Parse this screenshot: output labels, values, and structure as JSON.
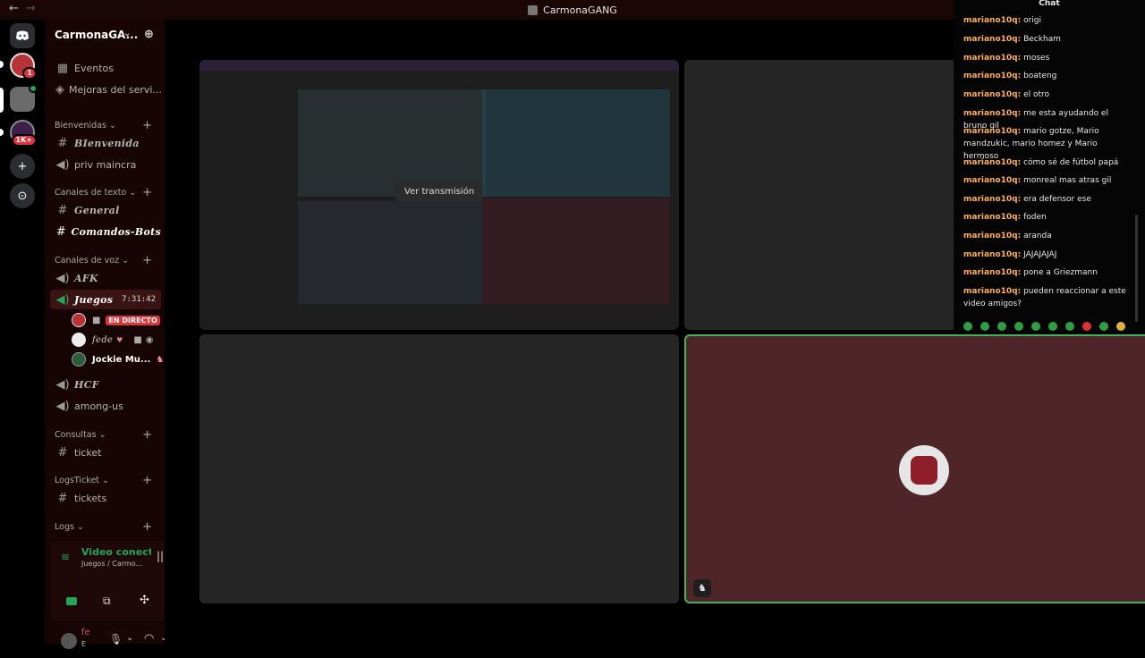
{
  "window": {
    "title": "CarmonaGANG",
    "back": "←",
    "forward": "→"
  },
  "guilds": [
    {
      "name": "discord-home",
      "glyph": "◎"
    },
    {
      "name": "server-1",
      "badge": "1"
    },
    {
      "name": "server-2"
    },
    {
      "name": "server-3",
      "badge": "1K+"
    },
    {
      "name": "add-server",
      "glyph": "+"
    },
    {
      "name": "discover",
      "glyph": "⊙"
    }
  ],
  "server": {
    "name": "CarmonaGA...",
    "chevron": "⌄",
    "invite": "⊕"
  },
  "top_items": [
    {
      "label": "Eventos",
      "icon": "▦"
    },
    {
      "label": "Mejoras del servi...",
      "icon": "◈"
    }
  ],
  "categories": {
    "bienvenidas": "Bienvenidas",
    "texto": "Canales de texto",
    "voz": "Canales de voz",
    "consultas": "Consultas",
    "logsticket": "LogsTicket",
    "logs": "Logs"
  },
  "channels": {
    "bienvenida": "BIenvenida",
    "priv_maincra": "priv maincra",
    "general": "General",
    "comandos": "Comandos-Bots",
    "afk": "AFK",
    "juegos": "Juegos",
    "juegos_timer": "7:31:42",
    "hcf": "HCF",
    "among": "among-us",
    "ticket": "ticket",
    "tickets": "tickets"
  },
  "voice_users": [
    {
      "name": "",
      "live": "EN DIRECTO"
    },
    {
      "name": "fede"
    },
    {
      "name": "Jockie Mu..."
    }
  ],
  "voice_panel": {
    "status": "Video conectac",
    "location": "Juegos / Carmo..."
  },
  "user": {
    "name": "fe",
    "status": "E"
  },
  "stage": {
    "watch_button": "Ver transmisión"
  },
  "chat": {
    "title": "Chat",
    "messages": [
      {
        "user": "mariano10q:",
        "text": " origi"
      },
      {
        "user": "mariano10q:",
        "text": " Beckham"
      },
      {
        "user": "mariano10q:",
        "text": " moses"
      },
      {
        "user": "mariano10q:",
        "text": " boateng"
      },
      {
        "user": "mariano10q:",
        "text": " el otro"
      },
      {
        "user": "mariano10q:",
        "text": " me esta ayudando el bruno gil"
      },
      {
        "user": "mariano10q:",
        "text": " mario gotze, Mario mandzukic, mario homez y Mario hermoso"
      },
      {
        "user": "mariano10q:",
        "text": " cómo sé de fútbol papá"
      },
      {
        "user": "mariano10q:",
        "text": " monreal mas atras gil"
      },
      {
        "user": "mariano10q:",
        "text": " era defensor ese"
      },
      {
        "user": "mariano10q:",
        "text": " foden"
      },
      {
        "user": "mariano10q:",
        "text": " aranda"
      },
      {
        "user": "mariano10q:",
        "text": " JAJAJAJAJ"
      },
      {
        "user": "mariano10q:",
        "text": " pone a Griezmann"
      },
      {
        "user": "mariano10q:",
        "text": " pueden reaccionar a este video amigos?"
      }
    ]
  },
  "colors": {
    "accent_green": "#23a559",
    "live_red": "#da373c",
    "chat_user": "#ffae57",
    "active_tile": "#4e2529"
  }
}
